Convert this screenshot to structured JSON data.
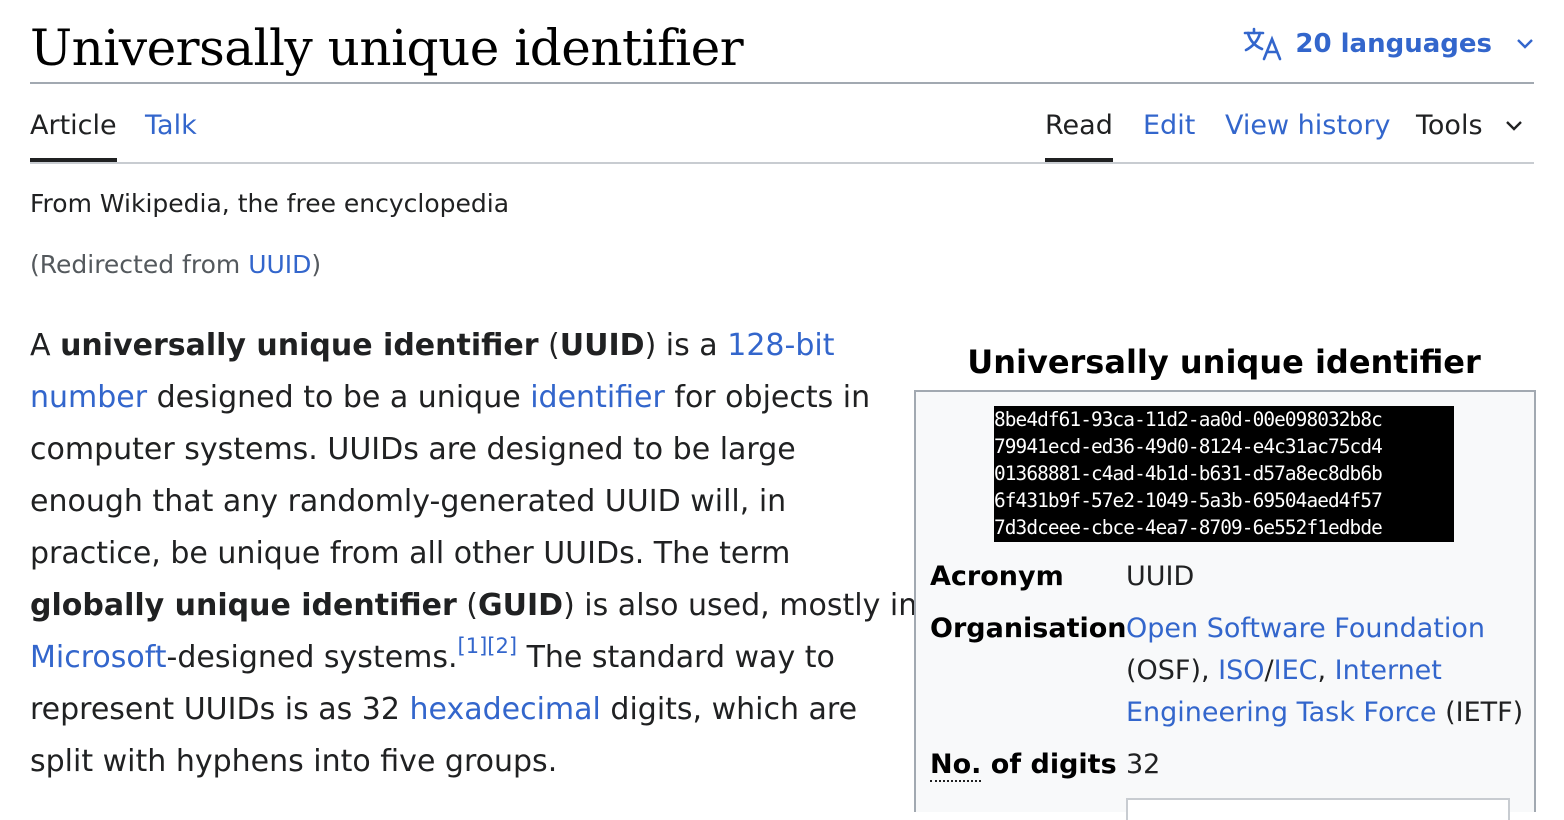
{
  "header": {
    "title": "Universally unique identifier",
    "languages_label": "20 languages",
    "icons": {
      "languages": "translate-icon",
      "chevron": "chevron-down-icon"
    }
  },
  "tabs": {
    "left": [
      "Article",
      "Talk"
    ],
    "right": [
      "Read",
      "Edit",
      "View history",
      "Tools"
    ],
    "selected": [
      "Article",
      "Read"
    ]
  },
  "tagline": "From Wikipedia, the free encyclopedia",
  "redirect": {
    "open": "(Redirected from ",
    "link": "UUID",
    "close": ")"
  },
  "lead": {
    "l1_a": "A ",
    "l1_b": "universally unique identifier",
    "l1_c": " (",
    "l1_d": "UUID",
    "l1_e": ") is a ",
    "l1_link": "128-bit",
    "l2_link1": "number",
    "l2_a": " designed to be a unique ",
    "l2_link2": "identifier",
    "l2_b": " for objects in",
    "l3": "computer systems. UUIDs are designed to be large",
    "l4": "enough that any randomly-generated UUID will, in",
    "l5": "practice, be unique from all other UUIDs. The term",
    "l6_a": "globally unique identifier",
    "l6_b": " (",
    "l6_c": "GUID",
    "l6_d": ") is also used, mostly in",
    "l7_link": "Microsoft",
    "l7_a": "-designed systems.",
    "l7_ref1": "[1]",
    "l7_ref2": "[2]",
    "l7_b": " The standard way to",
    "l8_a": "represent UUIDs is as 32 ",
    "l8_link": "hexadecimal",
    "l8_b": " digits, which are",
    "l9": "split with hyphens into five groups."
  },
  "infobox": {
    "caption": "Universally unique identifier",
    "image_lines": [
      "8be4df61-93ca-11d2-aa0d-00e098032b8c",
      "79941ecd-ed36-49d0-8124-e4c31ac75cd4",
      "01368881-c4ad-4b1d-b631-d57a8ec8db6b",
      "6f431b9f-57e2-1049-5a3b-69504aed4f57",
      "7d3dceee-cbce-4ea7-8709-6e552f1edbde"
    ],
    "acronym_label": "Acronym",
    "acronym_value": "UUID",
    "org_label": "Organisation",
    "org_link1": "Open Software Foundation",
    "org_text1": "(OSF), ",
    "org_link2": "ISO",
    "org_sep": "/",
    "org_link3": "IEC",
    "org_text2": ", ",
    "org_link4a": "Internet",
    "org_link4b": "Engineering Task Force",
    "org_text3": " (IETF)",
    "digits_label_abbr": "No.",
    "digits_label_rest": " of digits",
    "digits_value": "32"
  }
}
